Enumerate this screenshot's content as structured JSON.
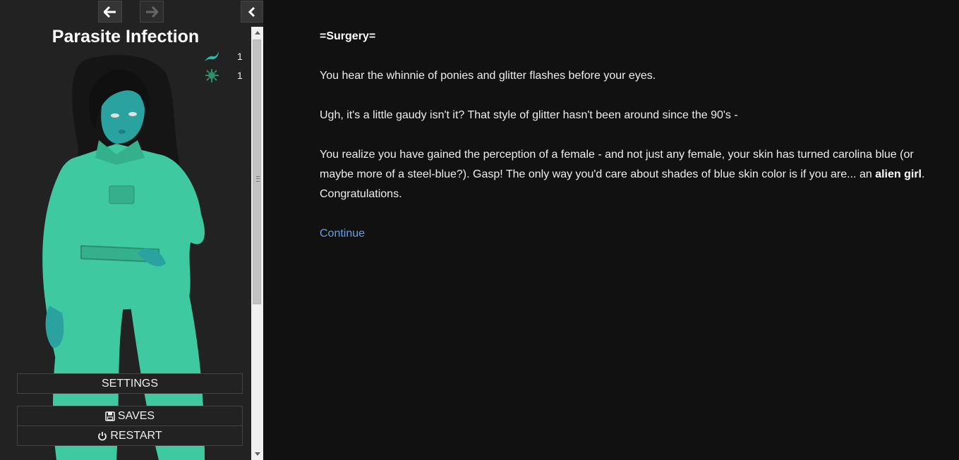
{
  "sidebar": {
    "title": "Parasite Infection",
    "status": [
      {
        "icon": "worm-icon",
        "value": "1"
      },
      {
        "icon": "spore-icon",
        "value": "1"
      }
    ],
    "menu": {
      "settings": "SETTINGS",
      "saves": "SAVES",
      "restart": "RESTART"
    }
  },
  "passage": {
    "heading": "=Surgery=",
    "p1": "You hear the whinnie of ponies and glitter flashes before your eyes.",
    "p2": "Ugh, it's a little gaudy isn't it? That style of glitter hasn't been around since the 90's -",
    "p3_a": "You realize you have gained the perception of a female - and not just any female, your skin has turned carolina blue (or maybe more of a steel-blue?). Gasp! The only way you'd care about shades of blue skin color is if you are... an ",
    "p3_bold": "alien girl",
    "p3_b": ". Congratulations.",
    "continue": "Continue"
  },
  "colors": {
    "background": "#111111",
    "sidebar": "#222222",
    "link": "#68a0e0",
    "skin": "#2aa3a0",
    "suit": "#3ec9a0"
  }
}
